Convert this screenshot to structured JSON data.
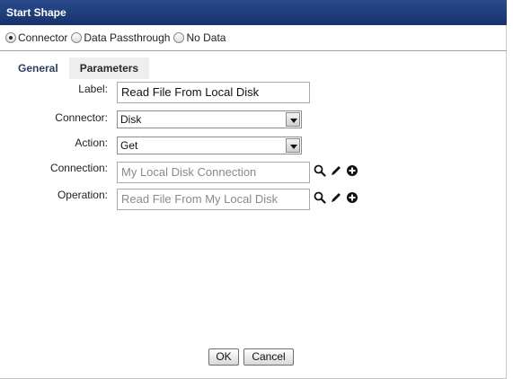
{
  "dialog": {
    "title": "Start Shape"
  },
  "start_type": {
    "options": [
      {
        "label": "Connector",
        "checked": true
      },
      {
        "label": "Data Passthrough",
        "checked": false
      },
      {
        "label": "No Data",
        "checked": false
      }
    ]
  },
  "tabs": [
    {
      "label": "General",
      "active": true
    },
    {
      "label": "Parameters",
      "active": false
    }
  ],
  "form": {
    "label": {
      "caption": "Label:",
      "value": "Read File From Local Disk"
    },
    "connector": {
      "caption": "Connector:",
      "value": "Disk"
    },
    "action": {
      "caption": "Action:",
      "value": "Get"
    },
    "connection": {
      "caption": "Connection:",
      "value": "My Local Disk Connection"
    },
    "operation": {
      "caption": "Operation:",
      "value": "Read File From My Local Disk"
    }
  },
  "icons": {
    "search": "search-icon",
    "edit": "pencil-icon",
    "add": "plus-circle-icon"
  },
  "buttons": {
    "ok": "OK",
    "cancel": "Cancel"
  },
  "colors": {
    "titlebar": "#1d3a78",
    "tab_active_text": "#2b3f5e"
  }
}
